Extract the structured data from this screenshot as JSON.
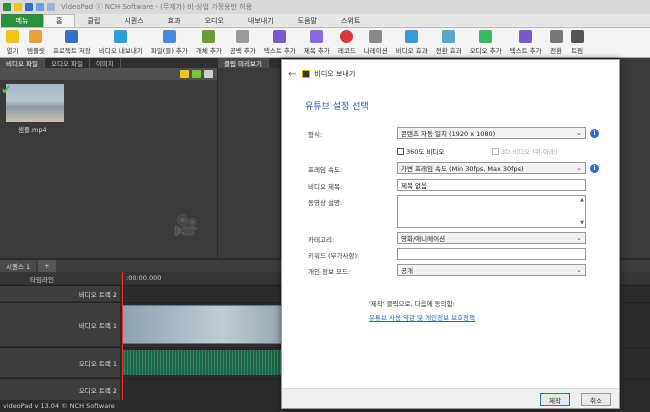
{
  "window": {
    "title": "VideoPad ⓒ NCH Software - (무제가) 비-상업 가정용만 허용"
  },
  "menu": {
    "menu_button": "메뉴",
    "tabs": [
      "홈",
      "클립",
      "시퀀스",
      "효과",
      "오디오",
      "내보내기",
      "도움말",
      "스위트"
    ]
  },
  "ribbon": {
    "buttons": [
      "열기",
      "템플릿",
      "프로젝트 저장",
      "비디오 내보내기",
      "파일(들) 추가",
      "개체 추가",
      "공백 추가",
      "텍스트 추가",
      "제목 추가",
      "레코드",
      "나레이션",
      "비디오 효과",
      "전환 효과",
      "오디오 추가",
      "텍스트 추가",
      "전환",
      "트림"
    ]
  },
  "media_panel": {
    "tabs": [
      "비디오 파일",
      "오디오 파일",
      "이미지"
    ],
    "file_name": "샘플.mp4"
  },
  "clip_preview": {
    "tab": "클립 미리보기"
  },
  "timeline": {
    "sequence_tab": "시퀀스 1",
    "add_tab": "+",
    "ruler_label": "타임라인",
    "ruler_time": ":00:00.000",
    "tracks": [
      {
        "label": "비디오 트랙 2"
      },
      {
        "label": "비디오 트랙 1"
      },
      {
        "label": "오디오 트랙 1"
      },
      {
        "label": "오디오 트랙 2"
      }
    ]
  },
  "status": {
    "text": "videoPad v 13.04 © NCH Software"
  },
  "dialog": {
    "header": "비디오 보내기",
    "subtitle": "유튜브 설정 선택",
    "format_label": "형식:",
    "format_value": "콘텐츠 자동 일치 (1920 x 1080)",
    "cb_360": "360도 비디오",
    "cb_3d": "3D 비디오 (위-아래)",
    "framerate_label": "프레임 속도:",
    "framerate_value": "가변 프레임 속도 (Min 30fps, Max 30fps)",
    "title_label": "비디오 제목:",
    "title_value": "제목 없음",
    "desc_label": "동영상 설명:",
    "category_label": "카테고리:",
    "category_value": "영화/애니메이션",
    "keywords_label": "키워드 (부가사항):",
    "privacy_label": "개인 정보 모드:",
    "privacy_value": "공개",
    "note": "'제작' 클릭으로, 다음에 동의함:",
    "link": "유튜브 사용 약관 및 개인정보 보호정책",
    "make_button": "제작",
    "cancel_button": "취소"
  },
  "colors": {
    "accent": "#2d6fd1",
    "menu_green": "#2a8f3a",
    "playhead": "#e33333"
  }
}
